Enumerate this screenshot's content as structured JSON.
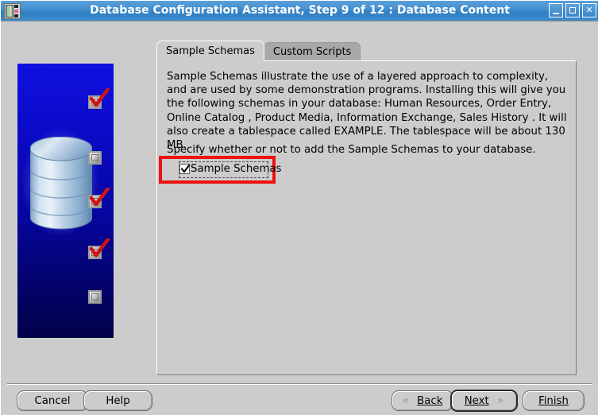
{
  "window": {
    "title": "Database Configuration Assistant, Step 9 of 12 : Database Content",
    "icon": "database-film-icon",
    "controls": {
      "minimize_label": "_",
      "maximize_label": "□",
      "close_label": "✕"
    }
  },
  "sidebar": {
    "image_name": "database-progress-graphic",
    "database_icon": "database-cylinder-icon",
    "steps": [
      {
        "name": "step-marker-1",
        "checked": true
      },
      {
        "name": "step-marker-2",
        "checked": false
      },
      {
        "name": "step-marker-3",
        "checked": true
      },
      {
        "name": "step-marker-4",
        "checked": true
      },
      {
        "name": "step-marker-5",
        "checked": false
      }
    ]
  },
  "tabs": [
    {
      "label": "Sample Schemas",
      "active": true
    },
    {
      "label": "Custom Scripts",
      "active": false
    }
  ],
  "content": {
    "paragraph1": "Sample Schemas illustrate the use of a layered approach to complexity, and are used by some demonstration programs. Installing this will give you the following schemas in your database: Human Resources, Order Entry, Online Catalog , Product Media, Information Exchange, Sales History . It will also create a tablespace called EXAMPLE. The tablespace will be about 130 MB.",
    "paragraph2": "Specify whether or not to add the Sample Schemas to your database.",
    "checkbox": {
      "label": "Sample Schemas",
      "checked": true,
      "focused": true,
      "highlight_color": "#ee1111"
    }
  },
  "footer": {
    "cancel_label": "Cancel",
    "help_label": "Help",
    "back_label": "Back",
    "back_mnemonic": "B",
    "next_label": "Next",
    "next_mnemonic": "N",
    "finish_label": "Finish",
    "finish_mnemonic": "F",
    "back_chevron": "«",
    "next_chevron": "»",
    "default_button": "Next"
  },
  "colors": {
    "titlebar_blue": "#3d8ccb",
    "dialog_gray": "#cccccc",
    "sidebar_blue": "#0b0bc8",
    "annotation_red": "#ee1111"
  }
}
